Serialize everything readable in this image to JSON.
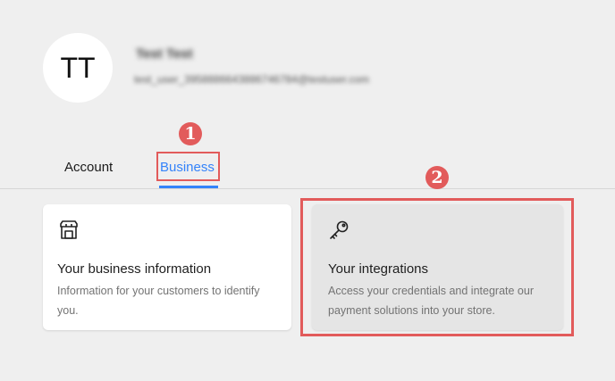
{
  "profile": {
    "initials": "TT",
    "name": "Test Test",
    "email": "test_user_3958886643886746784@testuser.com"
  },
  "tabs": [
    {
      "label": "Account",
      "active": false
    },
    {
      "label": "Business",
      "active": true
    }
  ],
  "annotations": {
    "step1": "1",
    "step2": "2",
    "color": "#e25b5b"
  },
  "cards": [
    {
      "icon": "store-icon",
      "title": "Your business information",
      "description": "Information for your customers to identify you."
    },
    {
      "icon": "key-icon",
      "title": "Your integrations",
      "description": "Access your credentials and integrate our payment solutions into your store."
    }
  ],
  "colors": {
    "accent": "#3483fa",
    "background": "#efefef",
    "card": "#ffffff",
    "card_hover": "#e5e5e5"
  }
}
